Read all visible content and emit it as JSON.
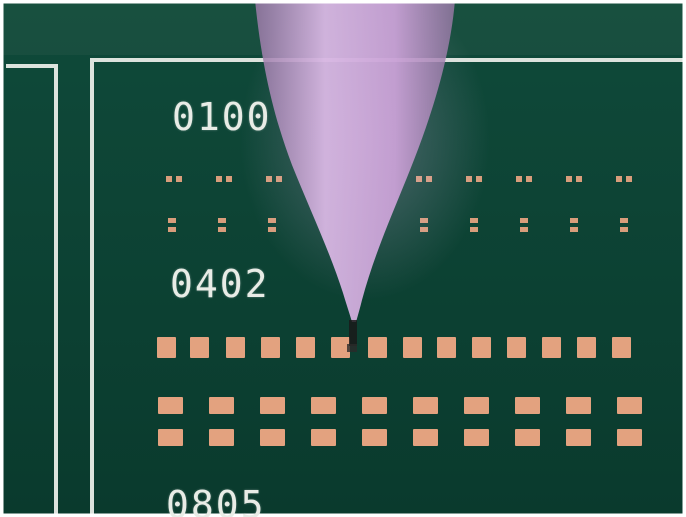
{
  "scene": {
    "description_free": true,
    "colors": {
      "board": "#0f4a3a",
      "board_dark": "#0a3a2d",
      "silkscreen": "#e8ece6",
      "pad": "#e3a27f",
      "pad_highlight": "#f2c3a6",
      "needle": "#c9a1d6",
      "needle_shadow": "#9a79a7"
    }
  },
  "labels": {
    "label_0100": "0100",
    "label_0402": "0402",
    "label_0805": "0805"
  }
}
